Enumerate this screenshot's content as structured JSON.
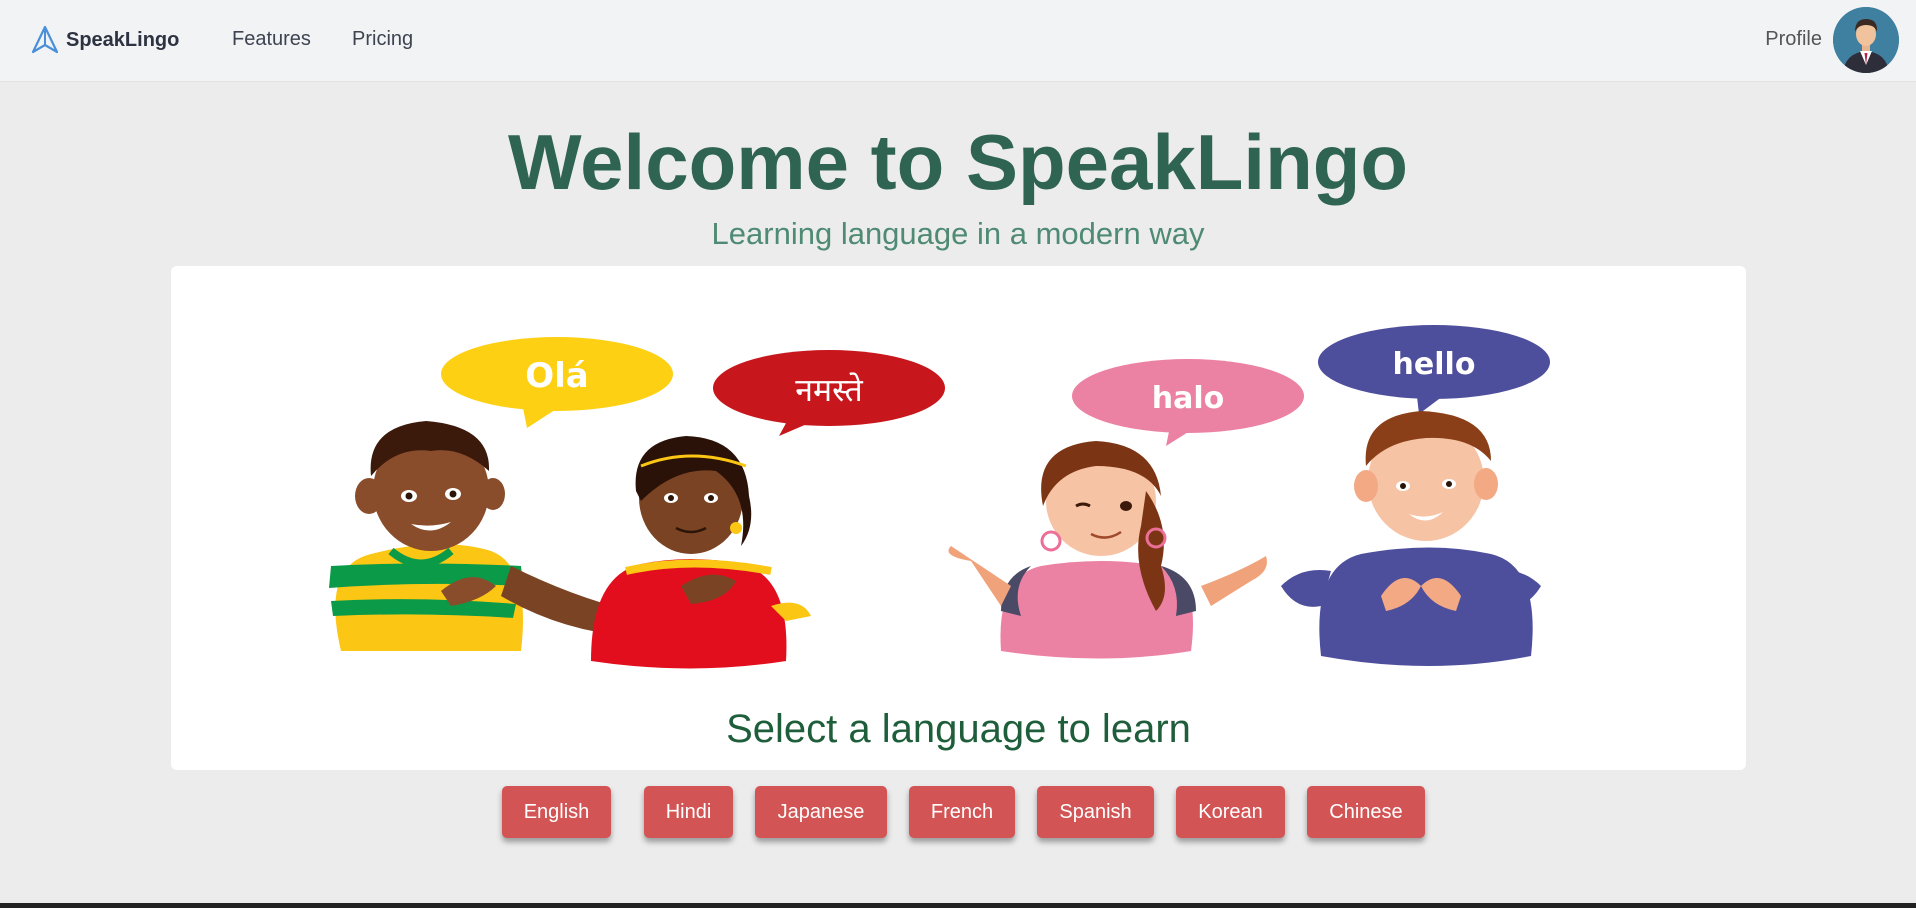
{
  "navbar": {
    "brand": "SpeakLingo",
    "links": [
      "Features",
      "Pricing"
    ],
    "profile_label": "Profile"
  },
  "hero": {
    "title": "Welcome to SpeakLingo",
    "subtitle": "Learning language in a modern way"
  },
  "illustration": {
    "greetings": [
      "Olá",
      "नमस्ते",
      "halo",
      "hello"
    ],
    "bubble_colors": [
      "#fdd014",
      "#c8161d",
      "#ec82a3",
      "#4e4f9c"
    ]
  },
  "main": {
    "prompt": "Select a language to learn"
  },
  "languages": [
    "English",
    "Hindi",
    "Japanese",
    "French",
    "Spanish",
    "Korean",
    "Chinese"
  ],
  "colors": {
    "title": "#2f6452",
    "subtitle": "#4f8a74",
    "button": "#d35454",
    "brand_icon": "#4a90d9"
  }
}
